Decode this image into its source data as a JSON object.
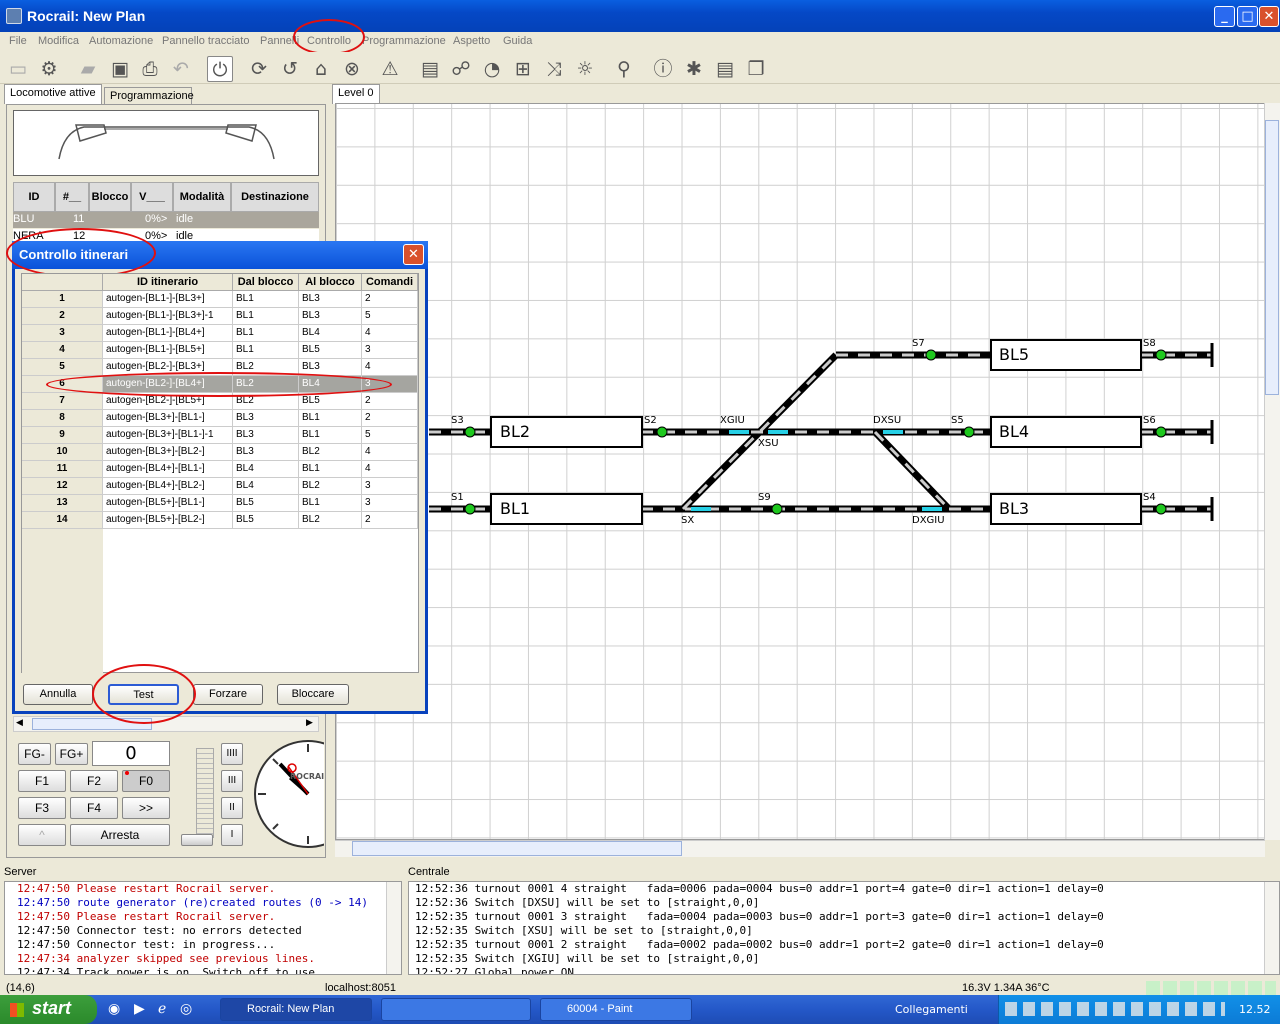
{
  "window": {
    "title": "Rocrail: New Plan",
    "min": "_",
    "max": "□",
    "close": "✕"
  },
  "menu": [
    "File",
    "Modifica",
    "Automazione",
    "Pannello tracciato",
    "Pannelli",
    "Controllo",
    "Programmazione",
    "Aspetto",
    "Guida"
  ],
  "left_tabs": {
    "active": "Locomotive attive",
    "inactive": "Programmazione"
  },
  "loco_table": {
    "headers": [
      "ID",
      "#__",
      "Blocco",
      "V___",
      "Modalità",
      "Destinazione"
    ],
    "rows": [
      {
        "id": "BLU",
        "num": "11",
        "blocco": "",
        "v": "0%>",
        "mode": "idle",
        "dest": ""
      },
      {
        "id": "NERA",
        "num": "12",
        "blocco": "",
        "v": "0%>",
        "mode": "idle",
        "dest": ""
      }
    ]
  },
  "canvas_tab": "Level 0",
  "dialog": {
    "title": "Controllo itinerari",
    "headers": [
      "",
      "ID itinerario",
      "Dal blocco",
      "Al blocco",
      "Comandi"
    ],
    "rows": [
      [
        "1",
        "autogen-[BL1-]-[BL3+]",
        "BL1",
        "BL3",
        "2"
      ],
      [
        "2",
        "autogen-[BL1-]-[BL3+]-1",
        "BL1",
        "BL3",
        "5"
      ],
      [
        "3",
        "autogen-[BL1-]-[BL4+]",
        "BL1",
        "BL4",
        "4"
      ],
      [
        "4",
        "autogen-[BL1-]-[BL5+]",
        "BL1",
        "BL5",
        "3"
      ],
      [
        "5",
        "autogen-[BL2-]-[BL3+]",
        "BL2",
        "BL3",
        "4"
      ],
      [
        "6",
        "autogen-[BL2-]-[BL4+]",
        "BL2",
        "BL4",
        "3"
      ],
      [
        "7",
        "autogen-[BL2-]-[BL5+]",
        "BL2",
        "BL5",
        "2"
      ],
      [
        "8",
        "autogen-[BL3+]-[BL1-]",
        "BL3",
        "BL1",
        "2"
      ],
      [
        "9",
        "autogen-[BL3+]-[BL1-]-1",
        "BL3",
        "BL1",
        "5"
      ],
      [
        "10",
        "autogen-[BL3+]-[BL2-]",
        "BL3",
        "BL2",
        "4"
      ],
      [
        "11",
        "autogen-[BL4+]-[BL1-]",
        "BL4",
        "BL1",
        "4"
      ],
      [
        "12",
        "autogen-[BL4+]-[BL2-]",
        "BL4",
        "BL2",
        "3"
      ],
      [
        "13",
        "autogen-[BL5+]-[BL1-]",
        "BL5",
        "BL1",
        "3"
      ],
      [
        "14",
        "autogen-[BL5+]-[BL2-]",
        "BL5",
        "BL2",
        "2"
      ]
    ],
    "selected_row": "6",
    "buttons": {
      "cancel": "Annulla",
      "test": "Test",
      "force": "Forzare",
      "lock": "Bloccare"
    }
  },
  "throttle": {
    "fg_minus": "FG-",
    "fg_plus": "FG+",
    "speed": "0",
    "f1": "F1",
    "f2": "F2",
    "f0": "F0",
    "f3": "F3",
    "f4": "F4",
    "next": ">>",
    "up": "^",
    "stop": "Arresta",
    "steps": [
      "IIII",
      "III",
      "II",
      "I"
    ],
    "clock_brand": "ROCRAIL"
  },
  "plan": {
    "blocks": [
      "BL1",
      "BL2",
      "BL3",
      "BL4",
      "BL5"
    ],
    "signals": [
      "S1",
      "S3",
      "S2",
      "S7",
      "S8",
      "S5",
      "S6",
      "S9",
      "S4"
    ],
    "switches": [
      "XGIU",
      "XSU",
      "DXSU",
      "DXGIU",
      "SX"
    ]
  },
  "server_log": {
    "label": "Server",
    "lines": [
      {
        "t": "12:47:50 Please restart Rocrail server.",
        "c": "#c00000"
      },
      {
        "t": "12:47:50 route generator (re)created routes (0 -> 14)",
        "c": "#0000c0"
      },
      {
        "t": "12:47:50 Please restart Rocrail server.",
        "c": "#c00000"
      },
      {
        "t": "12:47:50 Connector test: no errors detected",
        "c": "#000000"
      },
      {
        "t": "12:47:50 Connector test: in progress...",
        "c": "#000000"
      },
      {
        "t": "12:47:34 analyzer skipped see previous lines.",
        "c": "#c00000"
      },
      {
        "t": "12:47:34 Track power is on. Switch off to use",
        "c": "#000000"
      }
    ]
  },
  "central_log": {
    "label": "Centrale",
    "lines": [
      "12:52:36 turnout 0001 4 straight   fada=0006 pada=0004 bus=0 addr=1 port=4 gate=0 dir=1 action=1 delay=0",
      "12:52:36 Switch [DXSU] will be set to [straight,0,0]",
      "12:52:35 turnout 0001 3 straight   fada=0004 pada=0003 bus=0 addr=1 port=3 gate=0 dir=1 action=1 delay=0",
      "12:52:35 Switch [XSU] will be set to [straight,0,0]",
      "12:52:35 turnout 0001 2 straight   fada=0002 pada=0002 bus=0 addr=1 port=2 gate=0 dir=1 action=1 delay=0",
      "12:52:35 Switch [XGIU] will be set to [straight,0,0]",
      "12:52:27 Global power ON"
    ]
  },
  "status": {
    "coords": "(14,6)",
    "host": "localhost:8051",
    "power": "16.3V 1.34A 36°C"
  },
  "taskbar": {
    "start": "start",
    "tasks": [
      "Rocrail: New Plan",
      "",
      "60004 - Paint"
    ],
    "links": "Collegamenti",
    "clock": "12.52"
  }
}
